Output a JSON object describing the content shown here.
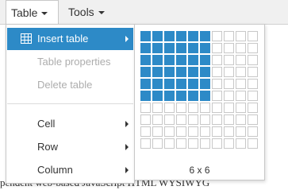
{
  "menubar": {
    "items": [
      {
        "label": "Table",
        "open": true
      },
      {
        "label": "Tools",
        "open": false
      }
    ]
  },
  "menu": {
    "items": [
      {
        "label": "Insert table",
        "state": "active",
        "submenu": true,
        "icon": "table-icon"
      },
      {
        "label": "Table properties",
        "state": "disabled",
        "submenu": false
      },
      {
        "label": "Delete table",
        "state": "disabled",
        "submenu": false
      },
      {
        "label": "Cell",
        "state": "normal",
        "submenu": true
      },
      {
        "label": "Row",
        "state": "normal",
        "submenu": true
      },
      {
        "label": "Column",
        "state": "normal",
        "submenu": true
      }
    ]
  },
  "picker": {
    "columns": 10,
    "rows": 10,
    "selected_columns": 6,
    "selected_rows": 6,
    "size_label": "6 x 6",
    "highlight_color": "#2d8ac7"
  },
  "background": {
    "text": "pendent web-based JavaScript HTML WYSIWYG"
  },
  "colors": {
    "accent": "#2d8ac7",
    "menubar_bg": "#f0f0f0",
    "disabled_text": "#adadad"
  }
}
